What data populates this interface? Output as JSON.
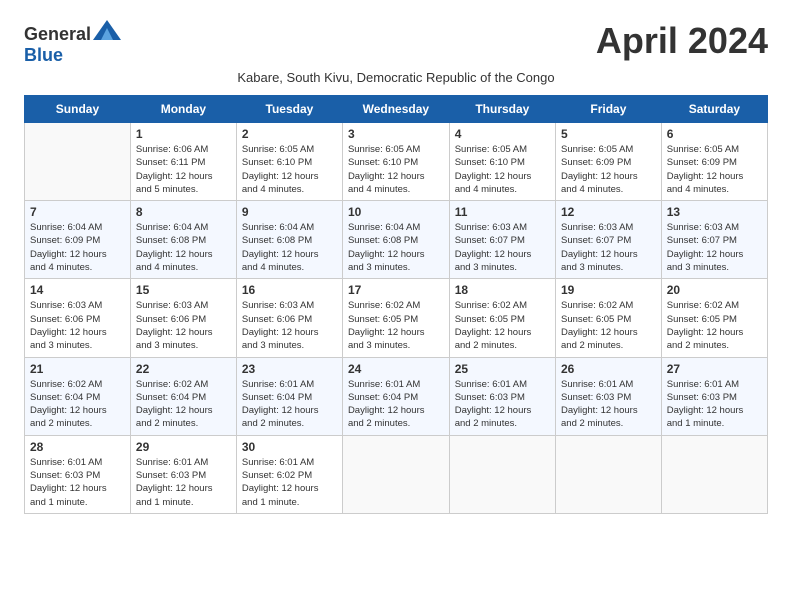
{
  "header": {
    "logo_general": "General",
    "logo_blue": "Blue",
    "month_title": "April 2024",
    "subtitle": "Kabare, South Kivu, Democratic Republic of the Congo"
  },
  "days_of_week": [
    "Sunday",
    "Monday",
    "Tuesday",
    "Wednesday",
    "Thursday",
    "Friday",
    "Saturday"
  ],
  "weeks": [
    [
      {
        "day": "",
        "info": ""
      },
      {
        "day": "1",
        "info": "Sunrise: 6:06 AM\nSunset: 6:11 PM\nDaylight: 12 hours\nand 5 minutes."
      },
      {
        "day": "2",
        "info": "Sunrise: 6:05 AM\nSunset: 6:10 PM\nDaylight: 12 hours\nand 4 minutes."
      },
      {
        "day": "3",
        "info": "Sunrise: 6:05 AM\nSunset: 6:10 PM\nDaylight: 12 hours\nand 4 minutes."
      },
      {
        "day": "4",
        "info": "Sunrise: 6:05 AM\nSunset: 6:10 PM\nDaylight: 12 hours\nand 4 minutes."
      },
      {
        "day": "5",
        "info": "Sunrise: 6:05 AM\nSunset: 6:09 PM\nDaylight: 12 hours\nand 4 minutes."
      },
      {
        "day": "6",
        "info": "Sunrise: 6:05 AM\nSunset: 6:09 PM\nDaylight: 12 hours\nand 4 minutes."
      }
    ],
    [
      {
        "day": "7",
        "info": "Sunrise: 6:04 AM\nSunset: 6:09 PM\nDaylight: 12 hours\nand 4 minutes."
      },
      {
        "day": "8",
        "info": "Sunrise: 6:04 AM\nSunset: 6:08 PM\nDaylight: 12 hours\nand 4 minutes."
      },
      {
        "day": "9",
        "info": "Sunrise: 6:04 AM\nSunset: 6:08 PM\nDaylight: 12 hours\nand 4 minutes."
      },
      {
        "day": "10",
        "info": "Sunrise: 6:04 AM\nSunset: 6:08 PM\nDaylight: 12 hours\nand 3 minutes."
      },
      {
        "day": "11",
        "info": "Sunrise: 6:03 AM\nSunset: 6:07 PM\nDaylight: 12 hours\nand 3 minutes."
      },
      {
        "day": "12",
        "info": "Sunrise: 6:03 AM\nSunset: 6:07 PM\nDaylight: 12 hours\nand 3 minutes."
      },
      {
        "day": "13",
        "info": "Sunrise: 6:03 AM\nSunset: 6:07 PM\nDaylight: 12 hours\nand 3 minutes."
      }
    ],
    [
      {
        "day": "14",
        "info": "Sunrise: 6:03 AM\nSunset: 6:06 PM\nDaylight: 12 hours\nand 3 minutes."
      },
      {
        "day": "15",
        "info": "Sunrise: 6:03 AM\nSunset: 6:06 PM\nDaylight: 12 hours\nand 3 minutes."
      },
      {
        "day": "16",
        "info": "Sunrise: 6:03 AM\nSunset: 6:06 PM\nDaylight: 12 hours\nand 3 minutes."
      },
      {
        "day": "17",
        "info": "Sunrise: 6:02 AM\nSunset: 6:05 PM\nDaylight: 12 hours\nand 3 minutes."
      },
      {
        "day": "18",
        "info": "Sunrise: 6:02 AM\nSunset: 6:05 PM\nDaylight: 12 hours\nand 2 minutes."
      },
      {
        "day": "19",
        "info": "Sunrise: 6:02 AM\nSunset: 6:05 PM\nDaylight: 12 hours\nand 2 minutes."
      },
      {
        "day": "20",
        "info": "Sunrise: 6:02 AM\nSunset: 6:05 PM\nDaylight: 12 hours\nand 2 minutes."
      }
    ],
    [
      {
        "day": "21",
        "info": "Sunrise: 6:02 AM\nSunset: 6:04 PM\nDaylight: 12 hours\nand 2 minutes."
      },
      {
        "day": "22",
        "info": "Sunrise: 6:02 AM\nSunset: 6:04 PM\nDaylight: 12 hours\nand 2 minutes."
      },
      {
        "day": "23",
        "info": "Sunrise: 6:01 AM\nSunset: 6:04 PM\nDaylight: 12 hours\nand 2 minutes."
      },
      {
        "day": "24",
        "info": "Sunrise: 6:01 AM\nSunset: 6:04 PM\nDaylight: 12 hours\nand 2 minutes."
      },
      {
        "day": "25",
        "info": "Sunrise: 6:01 AM\nSunset: 6:03 PM\nDaylight: 12 hours\nand 2 minutes."
      },
      {
        "day": "26",
        "info": "Sunrise: 6:01 AM\nSunset: 6:03 PM\nDaylight: 12 hours\nand 2 minutes."
      },
      {
        "day": "27",
        "info": "Sunrise: 6:01 AM\nSunset: 6:03 PM\nDaylight: 12 hours\nand 1 minute."
      }
    ],
    [
      {
        "day": "28",
        "info": "Sunrise: 6:01 AM\nSunset: 6:03 PM\nDaylight: 12 hours\nand 1 minute."
      },
      {
        "day": "29",
        "info": "Sunrise: 6:01 AM\nSunset: 6:03 PM\nDaylight: 12 hours\nand 1 minute."
      },
      {
        "day": "30",
        "info": "Sunrise: 6:01 AM\nSunset: 6:02 PM\nDaylight: 12 hours\nand 1 minute."
      },
      {
        "day": "",
        "info": ""
      },
      {
        "day": "",
        "info": ""
      },
      {
        "day": "",
        "info": ""
      },
      {
        "day": "",
        "info": ""
      }
    ]
  ]
}
